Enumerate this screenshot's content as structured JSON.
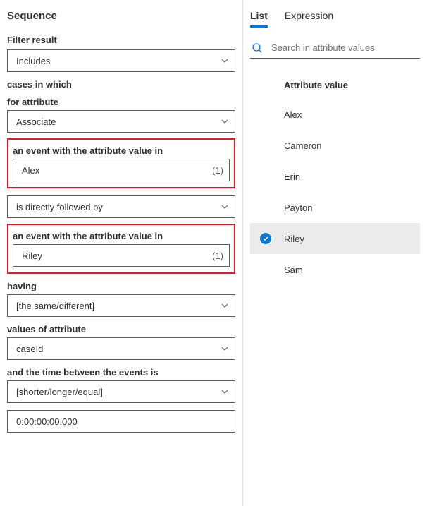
{
  "left": {
    "title": "Sequence",
    "filter_result_label": "Filter result",
    "filter_result_value": "Includes",
    "cases_label": "cases in which",
    "for_attribute_label": "for attribute",
    "for_attribute_value": "Associate",
    "event1_label": "an event with the attribute value in",
    "event1_value": "Alex",
    "event1_count": "(1)",
    "relation_value": "is directly followed by",
    "event2_label": "an event with the attribute value in",
    "event2_value": "Riley",
    "event2_count": "(1)",
    "having_label": "having",
    "having_value": "[the same/different]",
    "values_attr_label": "values of attribute",
    "values_attr_value": "caseId",
    "time_label": "and the time between the events is",
    "time_comp_value": "[shorter/longer/equal]",
    "time_value": "0:00:00:00.000"
  },
  "right": {
    "tabs": {
      "list": "List",
      "expression": "Expression"
    },
    "search_placeholder": "Search in attribute values",
    "attr_header": "Attribute value",
    "items": [
      {
        "label": "Alex",
        "selected": false
      },
      {
        "label": "Cameron",
        "selected": false
      },
      {
        "label": "Erin",
        "selected": false
      },
      {
        "label": "Payton",
        "selected": false
      },
      {
        "label": "Riley",
        "selected": true
      },
      {
        "label": "Sam",
        "selected": false
      }
    ]
  }
}
